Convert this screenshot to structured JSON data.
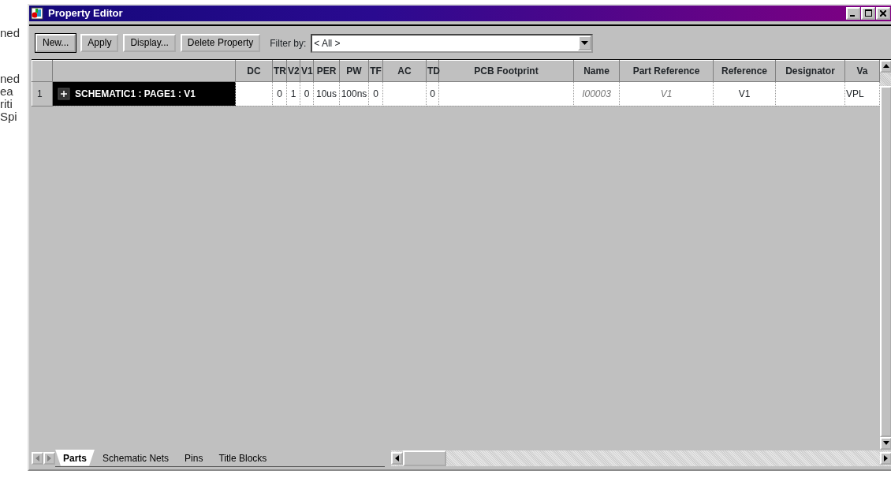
{
  "background_fragments": [
    "ned",
    "ned",
    "ea",
    "riti",
    "Spi"
  ],
  "window": {
    "title": "Property Editor"
  },
  "toolbar": {
    "buttons": [
      "New...",
      "Apply",
      "Display...",
      "Delete Property"
    ],
    "filter_label": "Filter by:",
    "filter_value": "< All >"
  },
  "table": {
    "columns": [
      {
        "kind": "name"
      },
      {
        "label": "DC",
        "kind": "value"
      },
      {
        "label": "TR",
        "kind": "value"
      },
      {
        "label": "V2",
        "kind": "value"
      },
      {
        "label": "V1",
        "kind": "value"
      },
      {
        "label": "PER",
        "kind": "value"
      },
      {
        "label": "PW",
        "kind": "value"
      },
      {
        "label": "TF",
        "kind": "value"
      },
      {
        "label": "AC",
        "kind": "value"
      },
      {
        "label": "TD",
        "kind": "value"
      },
      {
        "label": "PCB Footprint",
        "kind": "value"
      },
      {
        "label": "Name",
        "kind": "instance"
      },
      {
        "label": "Part Reference",
        "kind": "instance"
      },
      {
        "label": "Reference",
        "kind": "value"
      },
      {
        "label": "Designator",
        "kind": "value"
      },
      {
        "label": "Va",
        "kind": "left"
      }
    ],
    "rows": [
      {
        "number": "1",
        "selected": true,
        "expanded": false,
        "cells": [
          "SCHEMATIC1 : PAGE1 : V1",
          "",
          "0",
          "1",
          "0",
          "10us",
          "100ns",
          "0",
          "",
          "0",
          "",
          "I00003",
          "V1",
          "V1",
          "",
          "VPL"
        ]
      }
    ]
  },
  "tabs": [
    {
      "label": "Parts",
      "selected": true
    },
    {
      "label": "Schematic Nets",
      "selected": false
    },
    {
      "label": "Pins",
      "selected": false
    },
    {
      "label": "Title Blocks",
      "selected": false
    }
  ]
}
